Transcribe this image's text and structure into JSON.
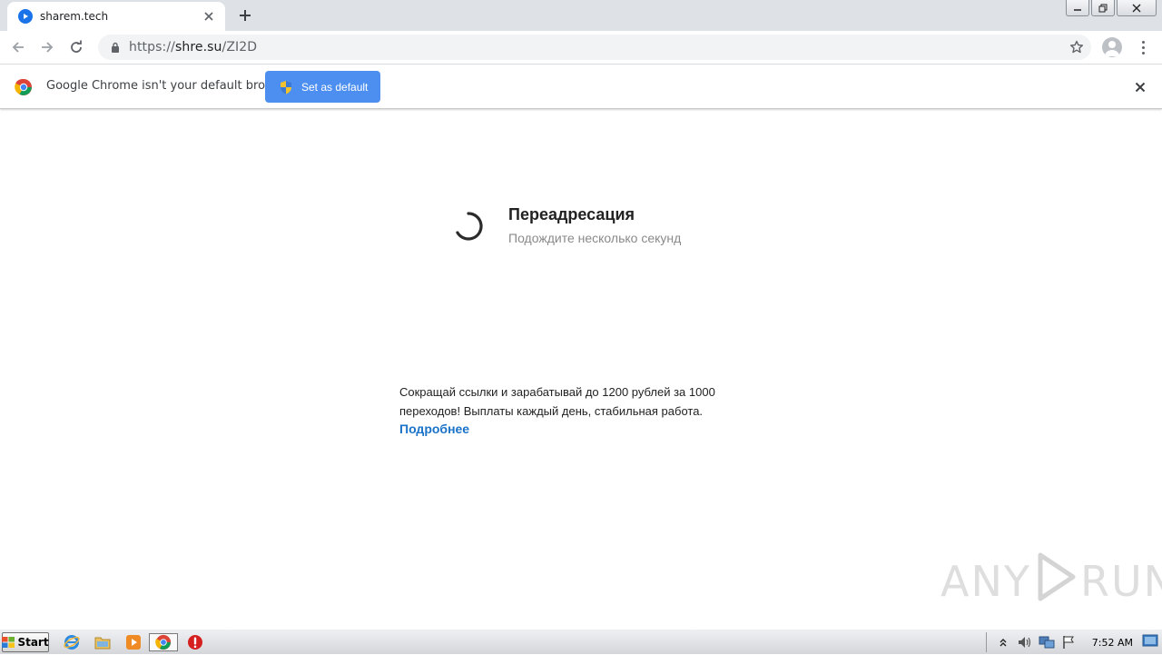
{
  "browser": {
    "tab_title": "sharem.tech",
    "url_scheme": "https://",
    "url_host": "shre.su",
    "url_path": "/ZI2D"
  },
  "infobar": {
    "message": "Google Chrome isn't your default browser",
    "button_label": "Set as default"
  },
  "page": {
    "title": "Переадресация",
    "subtitle": "Подождите несколько секунд",
    "promo_text": "Сокращай ссылки и зарабатывай до 1200 рублей за 1000 переходов! Выплаты каждый день, стабильная работа.",
    "promo_link": "Подробнее"
  },
  "watermark": {
    "left": "ANY",
    "right": "RUN"
  },
  "taskbar": {
    "start_label": "Start",
    "clock": "7:52 AM",
    "pinned": [
      "internet-explorer-icon",
      "file-explorer-icon",
      "media-player-icon",
      "chrome-icon",
      "stop-icon"
    ]
  },
  "colors": {
    "accent": "#4d8ff0",
    "link": "#1a73c9",
    "tab_strip": "#dee1e6"
  }
}
